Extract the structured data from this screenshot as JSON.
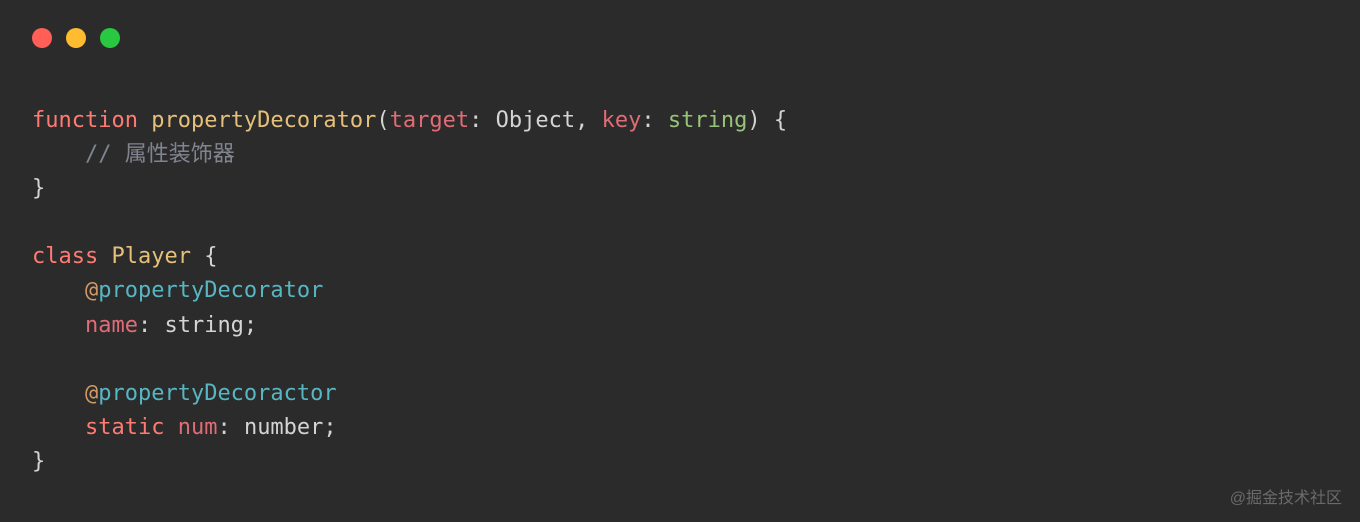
{
  "code": {
    "line1": {
      "kw": "function",
      "fname": "propertyDecorator",
      "open": "(",
      "p1": "target",
      "colon1": ": ",
      "t1": "Object",
      "comma": ", ",
      "p2": "key",
      "colon2": ": ",
      "t2": "string",
      "close": ") {"
    },
    "line2": {
      "indent": "    ",
      "comment": "// 属性装饰器"
    },
    "line3": {
      "brace": "}"
    },
    "line5": {
      "kw": "class",
      "name": "Player",
      "open": " {"
    },
    "line6": {
      "indent": "    ",
      "at": "@",
      "dec": "propertyDecorator"
    },
    "line7": {
      "indent": "    ",
      "name": "name",
      "rest": ": string;"
    },
    "line9": {
      "indent": "    ",
      "at": "@",
      "dec": "propertyDecoractor"
    },
    "line10": {
      "indent": "    ",
      "kw": "static",
      "name": " num",
      "rest": ": number;"
    },
    "line11": {
      "brace": "}"
    }
  },
  "watermark": "@掘金技术社区"
}
